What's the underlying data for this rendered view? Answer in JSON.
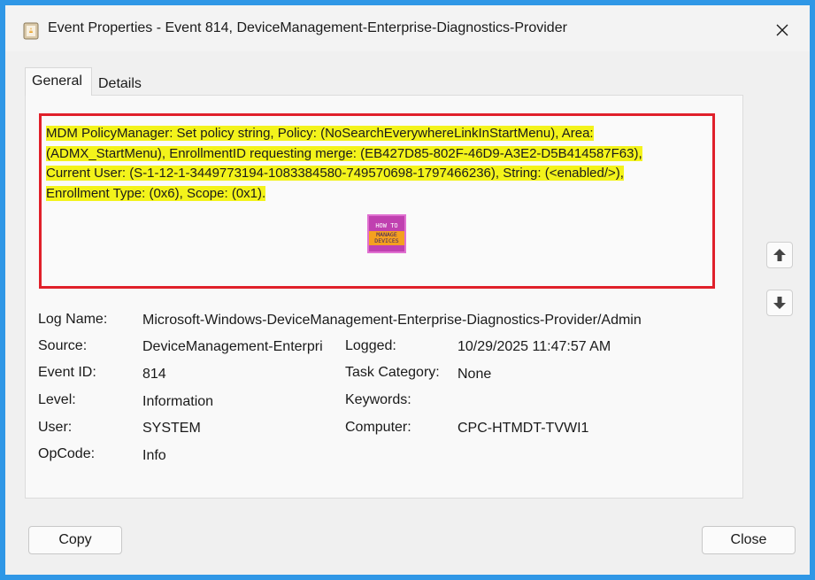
{
  "window": {
    "title": "Event Properties - Event 814, DeviceManagement-Enterprise-Diagnostics-Provider"
  },
  "tabs": [
    {
      "label": "General",
      "active": true
    },
    {
      "label": "Details",
      "active": false
    }
  ],
  "message": {
    "line1": "MDM PolicyManager: Set policy string, Policy: (NoSearchEverywhereLinkInStartMenu), Area:",
    "line2": "(ADMX_StartMenu), EnrollmentID requesting merge: (EB427D85-802F-46D9-A3E2-D5B414587F63),",
    "line3": "Current User: (S-1-12-1-3449773194-1083384580-749570698-1797466236), String: (<enabled/>),",
    "line4": "Enrollment Type: (0x6), Scope: (0x1).",
    "highlight_color": "#f3f31b",
    "box_border_color": "#e0202a"
  },
  "logo": {
    "line1": "HOW TO",
    "line2": "MANAGE DEVICES"
  },
  "fields": {
    "log_name_label": "Log Name:",
    "log_name_value": "Microsoft-Windows-DeviceManagement-Enterprise-Diagnostics-Provider/Admin",
    "source_label": "Source:",
    "source_value": "DeviceManagement-Enterpri",
    "logged_label": "Logged:",
    "logged_value": "10/29/2025 11:47:57 AM",
    "event_id_label": "Event ID:",
    "event_id_value": "814",
    "task_category_label": "Task Category:",
    "task_category_value": "None",
    "level_label": "Level:",
    "level_value": "Information",
    "keywords_label": "Keywords:",
    "keywords_value": "",
    "user_label": "User:",
    "user_value": "SYSTEM",
    "computer_label": "Computer:",
    "computer_value": "CPC-HTMDT-TVWI1",
    "opcode_label": "OpCode:",
    "opcode_value": "Info"
  },
  "buttons": {
    "copy": "Copy",
    "close": "Close"
  },
  "icons": {
    "up": "arrow-up-icon",
    "down": "arrow-down-icon",
    "close": "close-icon",
    "app": "event-viewer-icon"
  },
  "colors": {
    "frame": "#2f97e6",
    "dialog": "#f0f0f0"
  }
}
